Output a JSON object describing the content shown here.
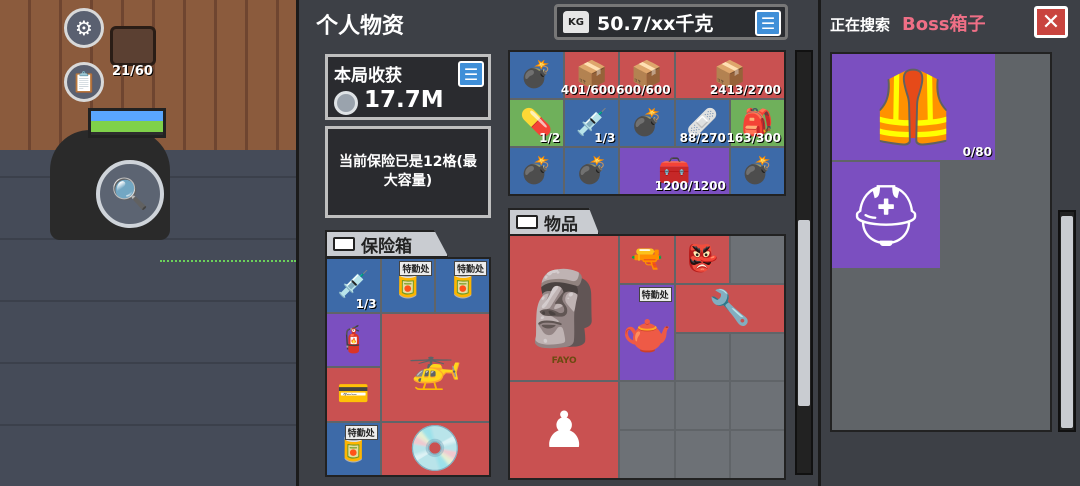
{
  "hud": {
    "settings_icon": "gear-icon",
    "quest_icon": "clipboard-icon",
    "backpack_count": "21/60",
    "search_icon": "magnifier-icon"
  },
  "personal": {
    "title": "个人物资",
    "weight": "50.7/xx千克",
    "weight_unit_badge": "KG",
    "harvest_label": "本局收获",
    "harvest_amount": "17.7M",
    "insurance_text": "当前保险已是12格(最大容量)",
    "safebox_label": "保险箱",
    "items_label": "物品"
  },
  "backpack_grid": [
    {
      "icon": "grenade-icon",
      "color": "blue",
      "count": ""
    },
    {
      "icon": "ammo-box-icon",
      "color": "red",
      "count": "401/600"
    },
    {
      "icon": "ammo-box-icon",
      "color": "red",
      "count": "600/600"
    },
    {
      "icon": "ammo-box-icon",
      "color": "red",
      "count": "2413/2700"
    },
    {
      "icon": "pills-icon",
      "color": "green",
      "count": "1/2"
    },
    {
      "icon": "syringe-icon",
      "color": "blue",
      "count": "1/3"
    },
    {
      "icon": "grenade-icon",
      "color": "blue",
      "count": ""
    },
    {
      "icon": "medkit-icon",
      "color": "blue",
      "count": "88/270"
    },
    {
      "icon": "bandage-bag-icon",
      "color": "green",
      "count": "163/300"
    },
    {
      "icon": "grenade-icon",
      "color": "blue",
      "count": ""
    },
    {
      "icon": "grenade-icon",
      "color": "blue",
      "count": ""
    },
    {
      "icon": "ammo-case-icon",
      "color": "purple",
      "count": "1200/1200"
    },
    {
      "icon": "grenade-icon",
      "color": "blue",
      "count": ""
    }
  ],
  "safebox": [
    {
      "icon": "syringe-icon",
      "count": "1/3",
      "tag": ""
    },
    {
      "icon": "jar-icon",
      "count": "",
      "tag": "特勤处"
    },
    {
      "icon": "jar-icon",
      "count": "",
      "tag": "特勤处"
    },
    {
      "icon": "gas-can-icon",
      "count": "",
      "tag": ""
    },
    {
      "icon": "drone-icon",
      "count": "",
      "tag": ""
    },
    {
      "icon": "card-icon",
      "count": "",
      "tag": ""
    },
    {
      "icon": "jar-icon",
      "count": "",
      "tag": "特勤处"
    },
    {
      "icon": "disc-icon",
      "count": "",
      "tag": ""
    }
  ],
  "items": {
    "bust_icon": "golden-bust-icon",
    "bust_inscription": "FAYO",
    "grip_icon": "grip-icon",
    "mask_icon": "mask-icon",
    "teapot_icon": "teapot-icon",
    "teapot_tag": "特勤处",
    "stock_icon": "stock-icon",
    "chess_icon": "chess-icon"
  },
  "loot": {
    "search_label": "正在搜索",
    "target": "Boss箱子",
    "close_label": "✕",
    "armor_count": "0/80",
    "armor_icon": "body-armor-icon",
    "helmet_icon": "helmet-icon"
  }
}
